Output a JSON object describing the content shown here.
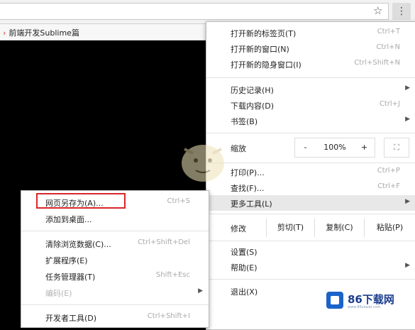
{
  "bookmark": {
    "title": "前端开发Sublime篇"
  },
  "icons": {
    "star": "star-icon",
    "menu": "kebab-menu-icon",
    "arrow": "chevron-right-icon"
  },
  "main_menu": {
    "new_tab": {
      "label": "打开新的标签页(T)",
      "shortcut": "Ctrl+T"
    },
    "new_window": {
      "label": "打开新的窗口(N)",
      "shortcut": "Ctrl+N"
    },
    "incognito": {
      "label": "打开新的隐身窗口(I)",
      "shortcut": "Ctrl+Shift+N"
    },
    "history": {
      "label": "历史记录(H)"
    },
    "downloads": {
      "label": "下载内容(D)",
      "shortcut": "Ctrl+J"
    },
    "bookmarks": {
      "label": "书签(B)"
    },
    "zoom": {
      "label": "缩放",
      "minus": "-",
      "value": "100%",
      "plus": "+",
      "fullscreen": "⛶"
    },
    "print": {
      "label": "打印(P)...",
      "shortcut": "Ctrl+P"
    },
    "find": {
      "label": "查找(F)...",
      "shortcut": "Ctrl+F"
    },
    "more_tools": {
      "label": "更多工具(L)"
    },
    "edit": {
      "label": "修改",
      "cut": "剪切(T)",
      "copy": "复制(C)",
      "paste": "粘贴(P)"
    },
    "settings": {
      "label": "设置(S)"
    },
    "help": {
      "label": "帮助(E)"
    },
    "exit": {
      "label": "退出(X)"
    }
  },
  "sub_menu": {
    "save_as": {
      "label": "网页另存为(A)...",
      "shortcut": "Ctrl+S"
    },
    "add_desktop": {
      "label": "添加到桌面..."
    },
    "clear_data": {
      "label": "清除浏览数据(C)...",
      "shortcut": "Ctrl+Shift+Del"
    },
    "extensions": {
      "label": "扩展程序(E)"
    },
    "task_manager": {
      "label": "任务管理器(T)",
      "shortcut": "Shift+Esc"
    },
    "encoding": {
      "label": "编码(E)"
    },
    "devtools": {
      "label": "开发者工具(D)",
      "shortcut": "Ctrl+Shift+I"
    }
  },
  "watermark": {
    "brand": "86下载网",
    "url": "www.86xiazai.com"
  },
  "colors": {
    "highlight_box": "#d9262a",
    "brand": "#1b63c9"
  }
}
